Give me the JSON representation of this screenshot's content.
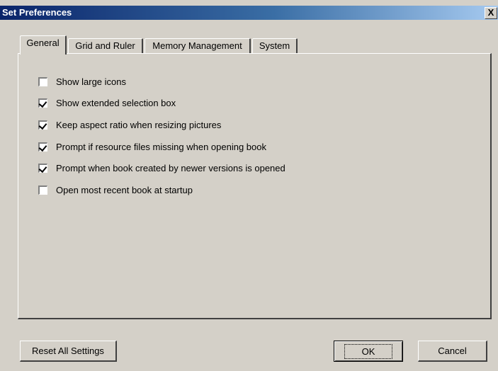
{
  "window": {
    "title": "Set Preferences",
    "close_label": "X"
  },
  "tabs": [
    {
      "label": "General",
      "active": true
    },
    {
      "label": "Grid and Ruler",
      "active": false
    },
    {
      "label": "Memory Management",
      "active": false
    },
    {
      "label": "System",
      "active": false
    }
  ],
  "options": [
    {
      "label": "Show large icons",
      "checked": false
    },
    {
      "label": "Show extended selection box",
      "checked": true
    },
    {
      "label": "Keep aspect ratio when resizing pictures",
      "checked": true
    },
    {
      "label": "Prompt if resource files missing when opening book",
      "checked": true
    },
    {
      "label": "Prompt when book created by newer versions is opened",
      "checked": true
    },
    {
      "label": "Open most recent book at startup",
      "checked": false
    }
  ],
  "buttons": {
    "reset": "Reset All Settings",
    "ok": "OK",
    "cancel": "Cancel"
  }
}
